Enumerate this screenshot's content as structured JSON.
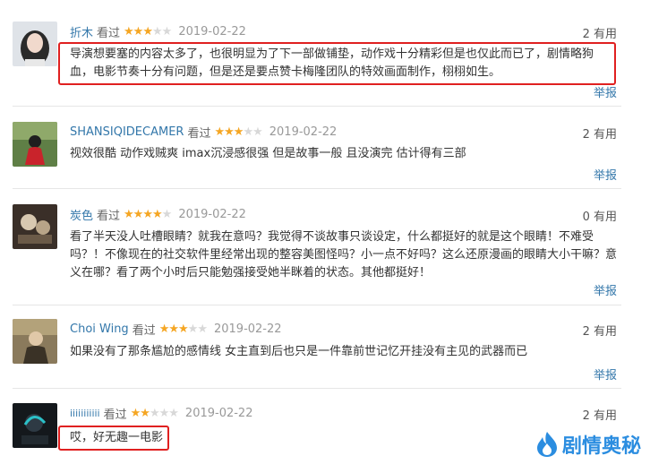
{
  "reviews": [
    {
      "user": "折木",
      "watched": "看过",
      "rating": 3,
      "date": "2019-02-22",
      "useful": "2 有用",
      "content": "导演想要塞的内容太多了，也很明显为了下一部做铺垫，动作戏十分精彩但是也仅此而已了，剧情略狗血，电影节奏十分有问题，但是还是要点赞卡梅隆团队的特效画面制作，栩栩如生。",
      "report": "举报"
    },
    {
      "user": "SHANSIQIDECAMER",
      "watched": "看过",
      "rating": 3,
      "date": "2019-02-22",
      "useful": "2 有用",
      "content": "视效很酷 动作戏贼爽 imax沉浸感很强 但是故事一般 且没演完 估计得有三部",
      "report": "举报"
    },
    {
      "user": "炭色",
      "watched": "看过",
      "rating": 4,
      "date": "2019-02-22",
      "useful": "0 有用",
      "content": "看了半天没人吐槽眼睛？就我在意吗？我觉得不谈故事只谈设定，什么都挺好的就是这个眼睛！不难受吗？！不像现在的社交软件里经常出现的整容美图怪吗？小一点不好吗？这么还原漫画的眼睛大小干嘛？意义在哪？看了两个小时后只能勉强接受她半眯着的状态。其他都挺好！",
      "report": "举报"
    },
    {
      "user": "Choi Wing",
      "watched": "看过",
      "rating": 3,
      "date": "2019-02-22",
      "useful": "2 有用",
      "content": "如果没有了那条尴尬的感情线 女主直到后也只是一件靠前世记忆开挂没有主见的武器而已",
      "report": "举报"
    },
    {
      "user": "iiiiiiiiiii",
      "watched": "看过",
      "rating": 2,
      "date": "2019-02-22",
      "useful": "2 有用",
      "content": "哎，好无趣一电影",
      "report": ""
    }
  ],
  "watermark": {
    "text": "剧情奥秘",
    "color": "#2b8de0"
  },
  "colors": {
    "user_link": "#3377aa",
    "star": "#f5a623",
    "highlight": "#e02020"
  }
}
